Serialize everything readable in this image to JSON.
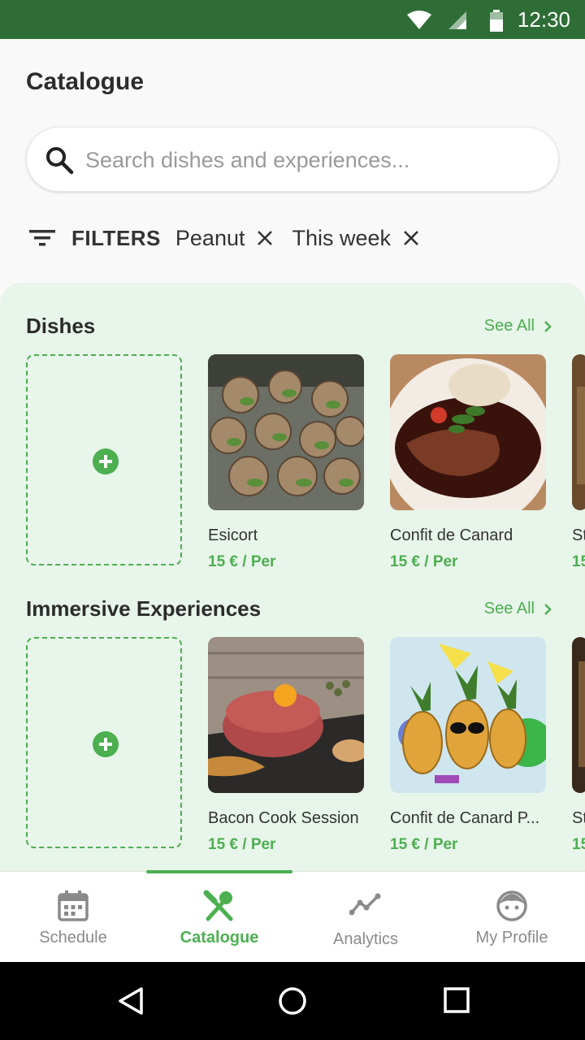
{
  "status_bar": {
    "time": "12:30",
    "icons": [
      "wifi-icon",
      "signal-icon",
      "battery-icon"
    ],
    "background": "#2e6e36"
  },
  "page": {
    "title": "Catalogue"
  },
  "search": {
    "placeholder": "Search dishes and experiences...",
    "value": ""
  },
  "filters": {
    "label": "FILTERS",
    "chips": [
      {
        "label": "Peanut"
      },
      {
        "label": "This week"
      }
    ]
  },
  "sections": {
    "dishes": {
      "title": "Dishes",
      "see_all": "See All",
      "items": [
        {
          "name": "Esicort",
          "price": "15 € / Per"
        },
        {
          "name": "Confit de Canard",
          "price": "15 € / Per"
        },
        {
          "name": "St",
          "price": "15"
        }
      ]
    },
    "experiences": {
      "title": "Immersive Experiences",
      "see_all": "See All",
      "items": [
        {
          "name": "Bacon Cook Session",
          "price": "15 € / Per"
        },
        {
          "name": "Confit de Canard P...",
          "price": "15 € / Per"
        },
        {
          "name": "St",
          "price": "15"
        }
      ]
    }
  },
  "bottom_nav": {
    "items": [
      {
        "label": "Schedule",
        "icon": "calendar-icon",
        "active": false
      },
      {
        "label": "Catalogue",
        "icon": "fork-knife-icon",
        "active": true
      },
      {
        "label": "Analytics",
        "icon": "analytics-icon",
        "active": false
      },
      {
        "label": "My Profile",
        "icon": "profile-face-icon",
        "active": false
      }
    ]
  },
  "colors": {
    "accent": "#4caf50",
    "content_background": "#e8f5ea",
    "status_bar": "#2e6e36"
  }
}
